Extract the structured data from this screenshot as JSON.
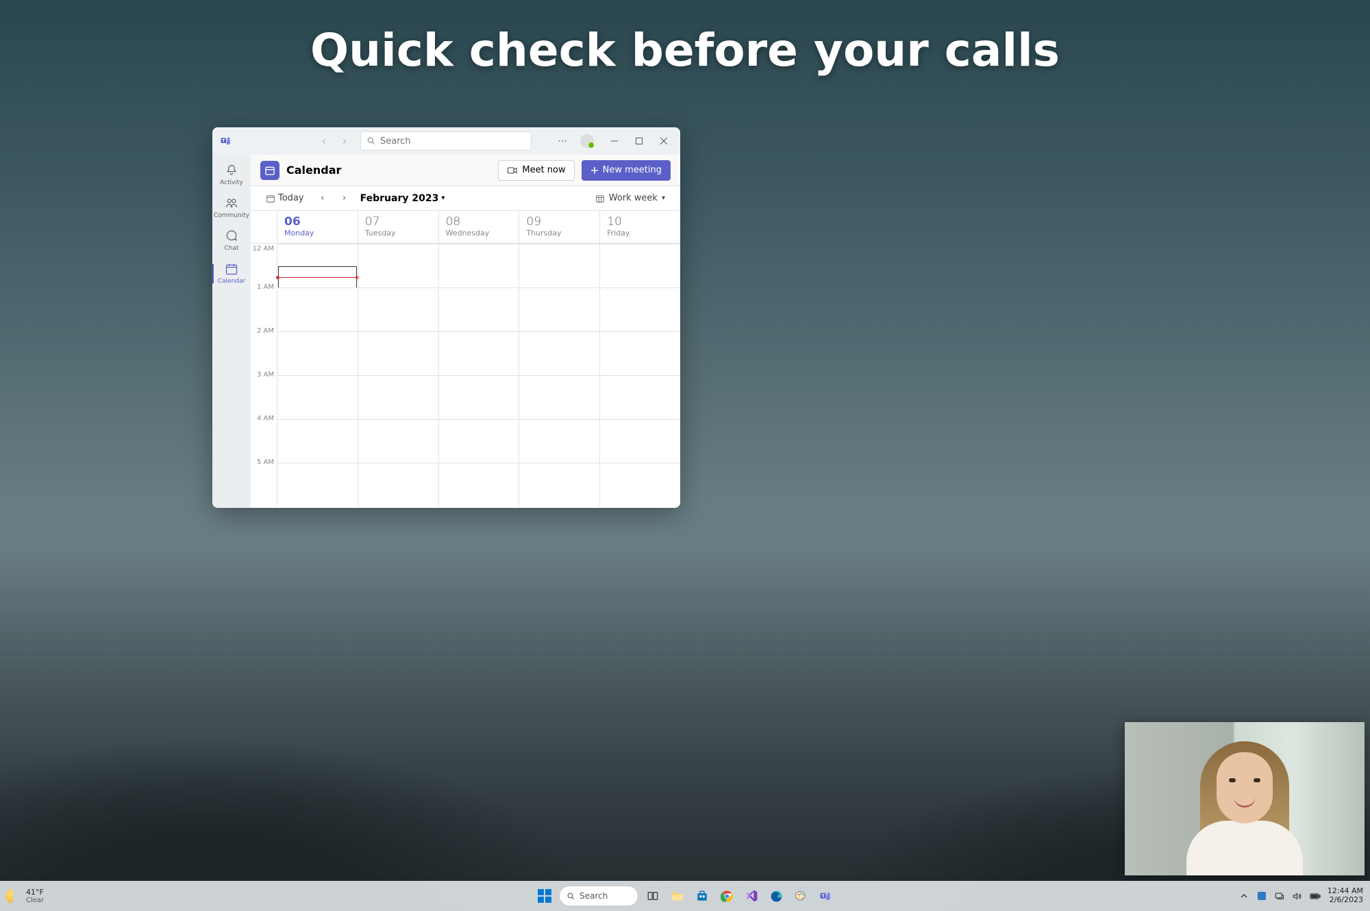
{
  "heading": "Quick check before your calls",
  "teams": {
    "search_placeholder": "Search",
    "rail": {
      "activity": "Activity",
      "community": "Community",
      "chat": "Chat",
      "calendar": "Calendar"
    },
    "panel_title": "Calendar",
    "meet_now": "Meet now",
    "new_meeting": "New meeting",
    "today_label": "Today",
    "month_label": "February 2023",
    "view_label": "Work week",
    "days": [
      {
        "num": "06",
        "name": "Monday",
        "today": true
      },
      {
        "num": "07",
        "name": "Tuesday",
        "today": false
      },
      {
        "num": "08",
        "name": "Wednesday",
        "today": false
      },
      {
        "num": "09",
        "name": "Thursday",
        "today": false
      },
      {
        "num": "10",
        "name": "Friday",
        "today": false
      }
    ],
    "hours": [
      "12 AM",
      "1 AM",
      "2 AM",
      "3 AM",
      "4 AM",
      "5 AM"
    ]
  },
  "taskbar": {
    "weather_temp": "41°F",
    "weather_text": "Clear",
    "search_label": "Search",
    "time": "12:44 AM",
    "date": "2/6/2023"
  }
}
